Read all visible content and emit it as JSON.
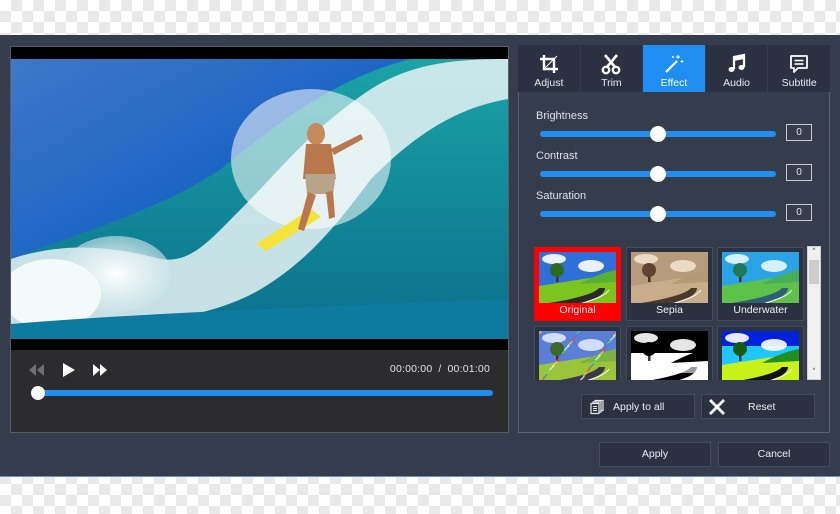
{
  "player": {
    "current_time": "00:00:00",
    "separator": "/",
    "total_time": "00:01:00",
    "progress": 0.0,
    "buttons": {
      "rewind": "rewind-icon",
      "play": "play-icon",
      "fast_forward": "fast-forward-icon"
    }
  },
  "tabs": [
    {
      "label": "Adjust",
      "icon": "crop-icon",
      "active": false
    },
    {
      "label": "Trim",
      "icon": "scissors-icon",
      "active": false
    },
    {
      "label": "Effect",
      "icon": "magic-wand-icon",
      "active": true
    },
    {
      "label": "Audio",
      "icon": "music-note-icon",
      "active": false
    },
    {
      "label": "Subtitle",
      "icon": "subtitle-icon",
      "active": false
    }
  ],
  "adjustments": [
    {
      "label": "Brightness",
      "value": "0",
      "position": 0.5
    },
    {
      "label": "Contrast",
      "value": "0",
      "position": 0.5
    },
    {
      "label": "Saturation",
      "value": "0",
      "position": 0.5
    }
  ],
  "effects": [
    {
      "label": "Original",
      "selected": true
    },
    {
      "label": "Sepia",
      "selected": false
    },
    {
      "label": "Underwater",
      "selected": false
    },
    {
      "label": "",
      "selected": false
    },
    {
      "label": "",
      "selected": false
    },
    {
      "label": "",
      "selected": false
    }
  ],
  "effect_actions": {
    "apply_all_label": "Apply to all",
    "reset_label": "Reset"
  },
  "footer": {
    "apply_label": "Apply",
    "cancel_label": "Cancel"
  },
  "colors": {
    "accent": "#1e8ef2",
    "selected_effect": "#ff0000",
    "window_bg": "#353c4b"
  }
}
